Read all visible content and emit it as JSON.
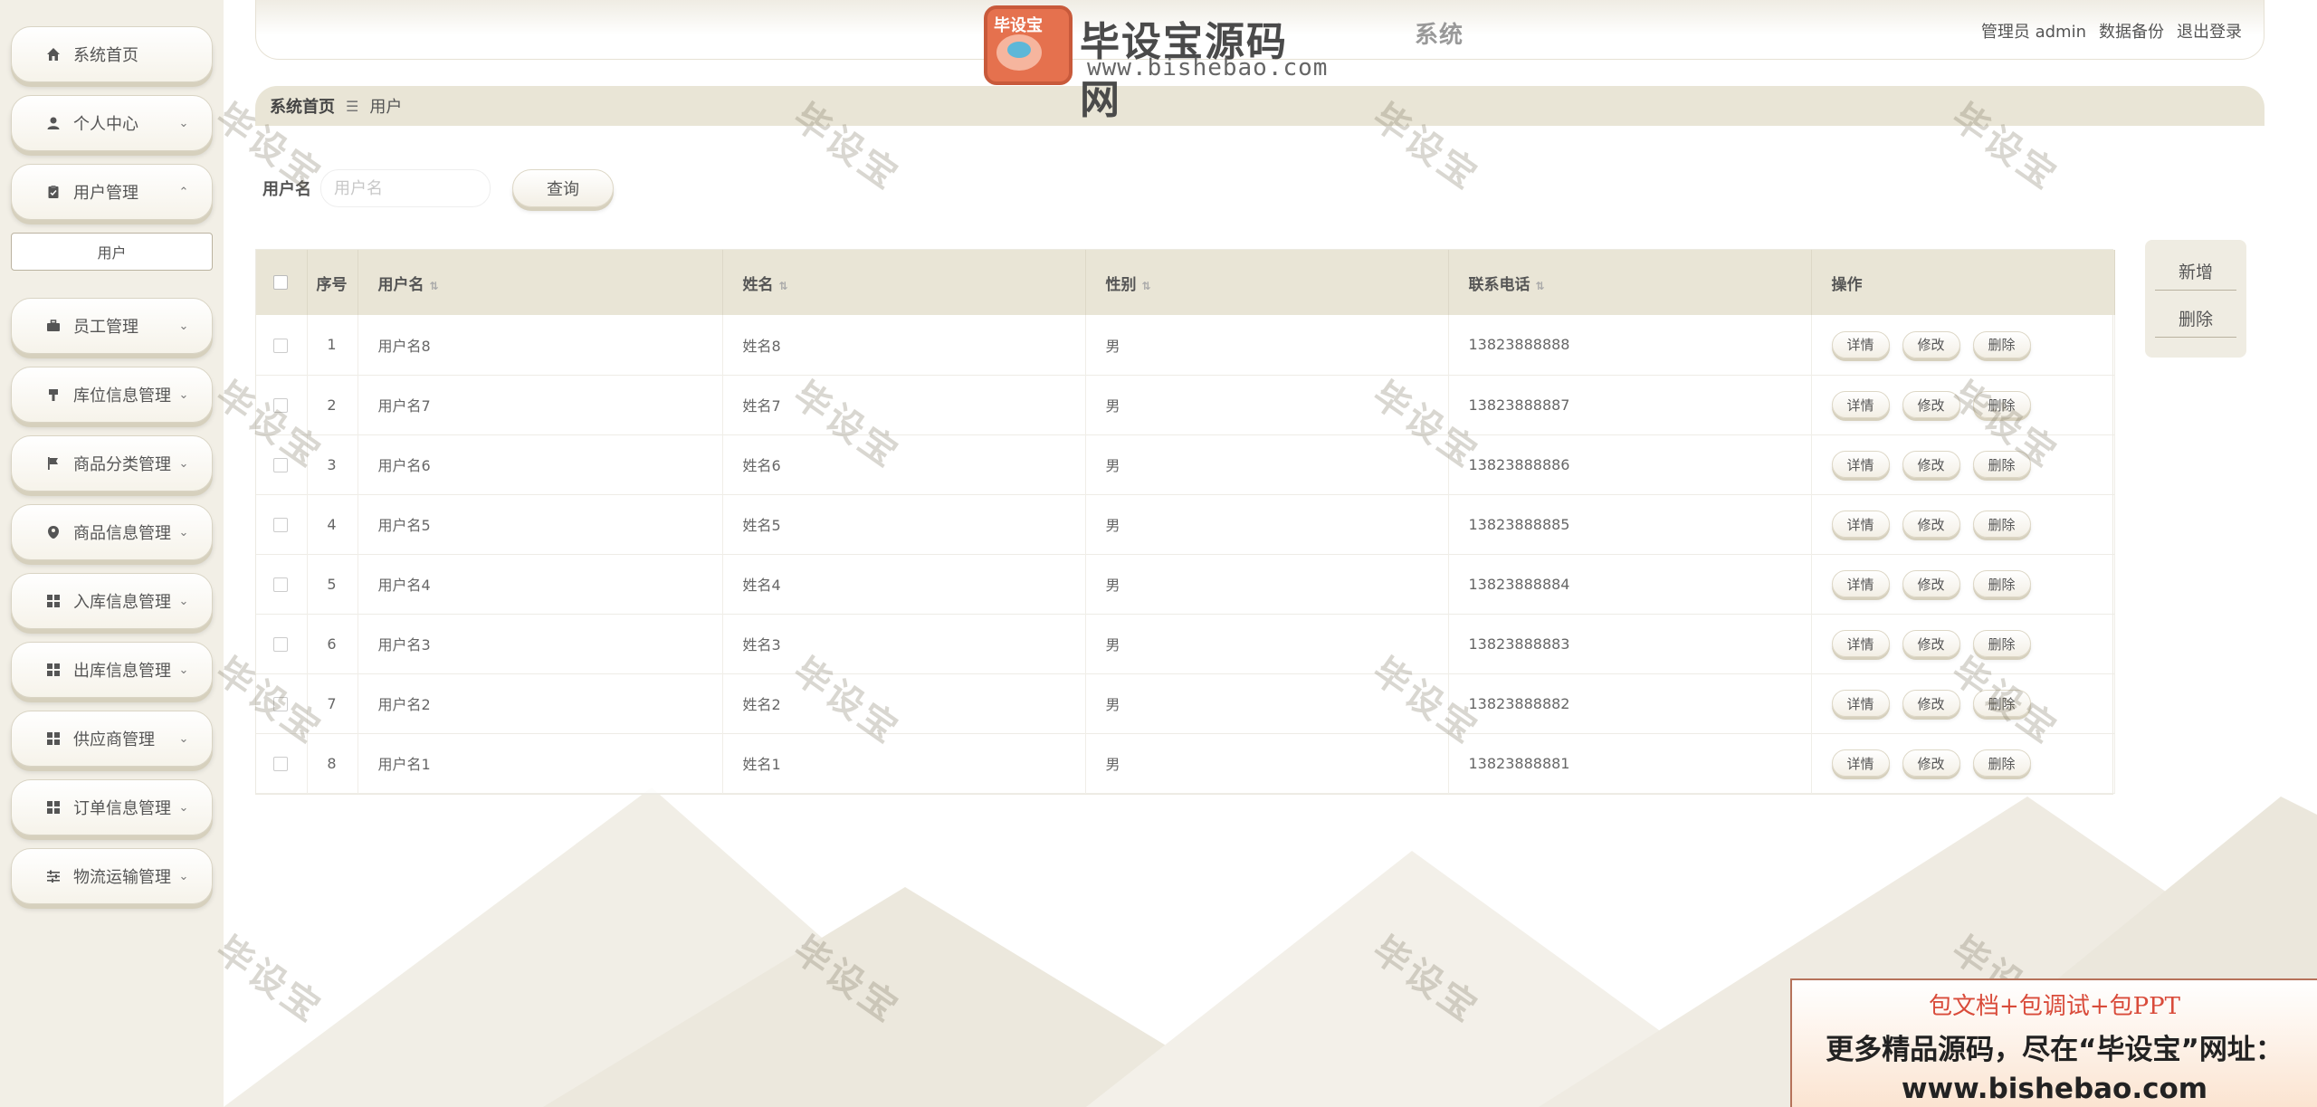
{
  "sidebar": {
    "items": [
      {
        "label": "系统首页",
        "icon": "home-icon",
        "chevron": ""
      },
      {
        "label": "个人中心",
        "icon": "user-icon",
        "chevron": "⌄"
      },
      {
        "label": "用户管理",
        "icon": "clipboard-icon",
        "chevron": "⌃"
      },
      {
        "label": "员工管理",
        "icon": "briefcase-icon",
        "chevron": "⌄"
      },
      {
        "label": "库位信息管理",
        "icon": "bookmark-icon",
        "chevron": "⌄"
      },
      {
        "label": "商品分类管理",
        "icon": "flag-icon",
        "chevron": "⌄"
      },
      {
        "label": "商品信息管理",
        "icon": "tag-icon",
        "chevron": "⌄"
      },
      {
        "label": "入库信息管理",
        "icon": "grid-icon",
        "chevron": "⌄"
      },
      {
        "label": "出库信息管理",
        "icon": "grid-icon",
        "chevron": "⌄"
      },
      {
        "label": "供应商管理",
        "icon": "grid-icon",
        "chevron": "⌄"
      },
      {
        "label": "订单信息管理",
        "icon": "grid-icon",
        "chevron": "⌄"
      },
      {
        "label": "物流运输管理",
        "icon": "sliders-icon",
        "chevron": "⌄"
      }
    ],
    "sub_item": "用户"
  },
  "header": {
    "title": "系统",
    "role": "管理员 admin",
    "backup": "数据备份",
    "logout": "退出登录"
  },
  "logo_watermark": {
    "badge": "毕设宝",
    "name": "毕设宝源码网",
    "url": "www.bishebao.com"
  },
  "breadcrumb": {
    "home": "系统首页",
    "sep": "☰",
    "current": "用户"
  },
  "search": {
    "label": "用户名",
    "placeholder": "用户名",
    "button": "查询"
  },
  "actions": {
    "add": "新增",
    "delete": "删除"
  },
  "table": {
    "headers": {
      "index": "序号",
      "username": "用户名",
      "name": "姓名",
      "gender": "性别",
      "phone": "联系电话",
      "ops": "操作"
    },
    "op_labels": {
      "detail": "详情",
      "edit": "修改",
      "delete": "删除"
    },
    "rows": [
      {
        "index": "1",
        "username": "用户名8",
        "name": "姓名8",
        "gender": "男",
        "phone": "13823888888"
      },
      {
        "index": "2",
        "username": "用户名7",
        "name": "姓名7",
        "gender": "男",
        "phone": "13823888887"
      },
      {
        "index": "3",
        "username": "用户名6",
        "name": "姓名6",
        "gender": "男",
        "phone": "13823888886"
      },
      {
        "index": "4",
        "username": "用户名5",
        "name": "姓名5",
        "gender": "男",
        "phone": "13823888885"
      },
      {
        "index": "5",
        "username": "用户名4",
        "name": "姓名4",
        "gender": "男",
        "phone": "13823888884"
      },
      {
        "index": "6",
        "username": "用户名3",
        "name": "姓名3",
        "gender": "男",
        "phone": "13823888883"
      },
      {
        "index": "7",
        "username": "用户名2",
        "name": "姓名2",
        "gender": "男",
        "phone": "13823888882"
      },
      {
        "index": "8",
        "username": "用户名1",
        "name": "姓名1",
        "gender": "男",
        "phone": "13823888881"
      }
    ]
  },
  "watermark_text": "毕设宝",
  "ad": {
    "line1": "包文档+包调试+包PPT",
    "line2": "更多精品源码，尽在“毕设宝”网址：",
    "line3": "www.bishebao.com"
  },
  "colors": {
    "accent_beige": "#e9e5d6",
    "sidebar_bg": "#f2efe6",
    "ad_red": "#d94b3a"
  }
}
